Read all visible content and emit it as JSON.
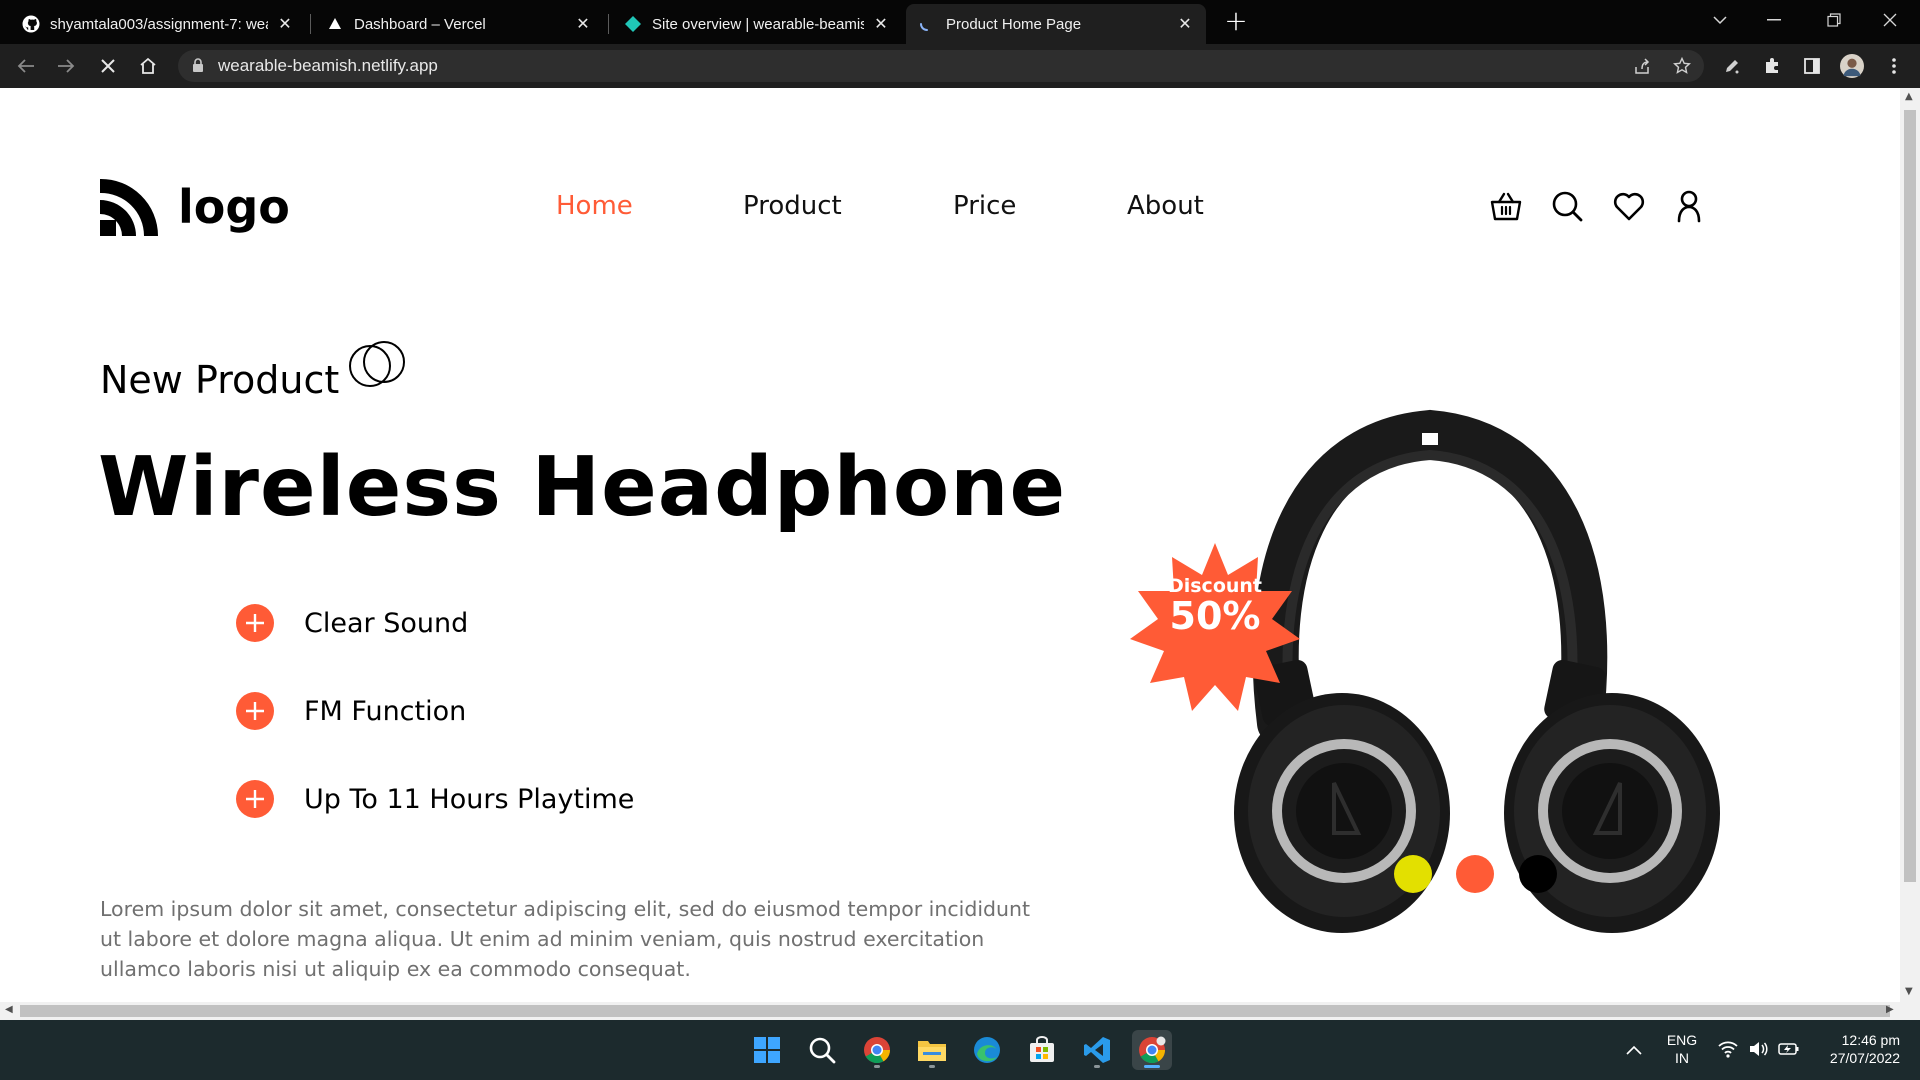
{
  "browser": {
    "tabs": [
      {
        "title": "shyamtala003/assignment-7: wea",
        "icon": "github-icon",
        "active": false
      },
      {
        "title": "Dashboard – Vercel",
        "icon": "vercel-icon",
        "active": false
      },
      {
        "title": "Site overview | wearable-beamish",
        "icon": "netlify-icon",
        "active": false
      },
      {
        "title": "Product Home Page",
        "icon": "loading-spinner-icon",
        "active": true
      }
    ],
    "url": "wearable-beamish.netlify.app"
  },
  "site": {
    "logo_text": "logo",
    "nav": [
      {
        "label": "Home",
        "active": true
      },
      {
        "label": "Product",
        "active": false
      },
      {
        "label": "Price",
        "active": false
      },
      {
        "label": "About",
        "active": false
      }
    ],
    "header_icons": [
      "basket-icon",
      "search-icon",
      "heart-icon",
      "user-icon"
    ]
  },
  "hero": {
    "eyebrow": "New Product",
    "title": "Wireless Headphone",
    "features": [
      "Clear Sound",
      "FM Function",
      "Up To 11 Hours Playtime"
    ],
    "description": "Lorem ipsum dolor sit amet, consectetur adipiscing elit, sed do eiusmod tempor incididunt ut labore et dolore magna aliqua. Ut enim ad minim veniam, quis nostrud exercitation ullamco laboris nisi ut aliquip ex ea commodo consequat.",
    "badge": {
      "label": "Discount",
      "value": "50%"
    },
    "swatches": [
      {
        "name": "yellow",
        "color": "#e3e000"
      },
      {
        "name": "orange",
        "color": "#ff5b36"
      },
      {
        "name": "black",
        "color": "#000000"
      }
    ],
    "accent_color": "#ff5b36"
  },
  "taskbar": {
    "apps": [
      "windows-start-icon",
      "search-icon",
      "chrome-icon",
      "file-explorer-icon",
      "edge-icon",
      "microsoft-store-icon",
      "vscode-icon",
      "chrome-canary-icon"
    ],
    "language": "ENG",
    "region": "IN",
    "time": "12:46 pm",
    "date": "27/07/2022"
  }
}
